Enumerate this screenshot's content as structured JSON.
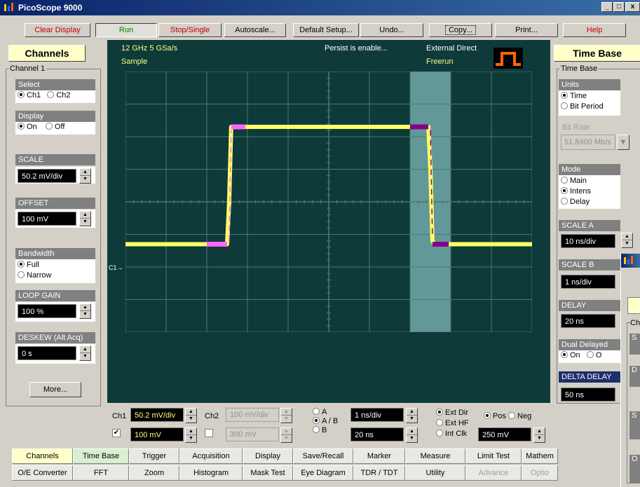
{
  "window": {
    "title": "PicoScope 9000",
    "controls": [
      "_",
      "□",
      "x"
    ]
  },
  "toolbar": {
    "clear_display": "Clear Display",
    "run": "Run",
    "stop_single": "Stop/Single",
    "autoscale": "Autoscale...",
    "default_setup": "Default Setup...",
    "undo": "Undo...",
    "copy": "Copy...",
    "print": "Print...",
    "help": "Help"
  },
  "channels_panel": {
    "header": "Channels",
    "group_label": "Channel 1",
    "select_label": "Select",
    "select_options": [
      "Ch1",
      "Ch2"
    ],
    "select_value": "Ch1",
    "display_label": "Display",
    "display_options": [
      "On",
      "Off"
    ],
    "display_value": "On",
    "scale_label": "SCALE",
    "scale_value": "50.2 mV/div",
    "offset_label": "OFFSET",
    "offset_value": "100 mV",
    "bandwidth_label": "Bandwidth",
    "bandwidth_options": [
      "Full",
      "Narrow"
    ],
    "bandwidth_value": "Full",
    "loop_gain_label": "LOOP GAIN",
    "loop_gain_value": "100 %",
    "deskew_label": "DESKEW (Alt Acq)",
    "deskew_value": "0 s",
    "more_button": "More..."
  },
  "scope": {
    "bandwidth_rate": "12 GHz  5 GSa/s",
    "mode": "Sample",
    "persist": "Persist  is enable...",
    "trigger_source": "External Direct",
    "trigger_mode": "Freerun",
    "channel_marker": "C1",
    "colors": {
      "background": "#0e3a3a",
      "grid": "#4a7a70",
      "trace": "#ffff66",
      "trace_highlight": "#ff66ff",
      "trace_delayed": "#880088",
      "window": "#7fb8b8"
    }
  },
  "chart_data": {
    "type": "line",
    "title": "",
    "xlabel": "",
    "ylabel": "",
    "grid": true,
    "divisions_x": 10,
    "divisions_y": 8,
    "timebase": "10 ns/div",
    "series": [
      {
        "name": "",
        "x_div": [
          0,
          2.5,
          2.55,
          2.6,
          2.65,
          7.45,
          7.5,
          7.55,
          7.6,
          10
        ],
        "y_div": [
          -1.3,
          -1.3,
          0,
          2.3,
          2.3,
          2.3,
          1.0,
          -1.2,
          -1.3,
          -1.3
        ]
      }
    ],
    "delayed_window_div": [
      7.0,
      8.0
    ]
  },
  "timebase_panel": {
    "header": "Time Base",
    "group_label": "Time Base",
    "units_label": "Units",
    "units_options": [
      "Time",
      "Bit Period"
    ],
    "units_value": "Time",
    "bit_rate_label": "Bit Rate",
    "bit_rate_value": "51.8400 Mb/s",
    "mode_label": "Mode",
    "mode_options": [
      "Main",
      "Intens",
      "Delay"
    ],
    "mode_value": "Intens",
    "scale_a_label": "SCALE A",
    "scale_a_value": "10 ns/div",
    "scale_b_label": "SCALE B",
    "scale_b_value": "1 ns/div",
    "delay_label": "DELAY",
    "delay_value": "20 ns",
    "dual_delayed_label": "Dual Delayed",
    "dual_delayed_options": [
      "On",
      "O"
    ],
    "dual_delayed_value": "On",
    "delta_delay_label": "DELTA DELAY",
    "delta_delay_value": "50 ns"
  },
  "bottom_controls": {
    "ch1_label": "Ch1",
    "ch1_scale": "50.2 mV/div",
    "ch1_offset": "100 mV",
    "ch2_label": "Ch2",
    "ch2_scale": "100 mV/div",
    "ch2_offset": "300 mV",
    "timebase_options": [
      "A",
      "A / B",
      "B"
    ],
    "timebase_value": "A / B",
    "timebase_a": "1 ns/div",
    "timebase_b": "20 ns",
    "trigger_options": [
      "Ext Dir",
      "Ext HF",
      "Int Clk"
    ],
    "trigger_value": "Ext Dir",
    "slope_options": [
      "Pos",
      "Neg"
    ],
    "slope_value": "Pos",
    "trigger_level": "250 mV"
  },
  "tabs_row1": [
    "Channels",
    "Time Base",
    "Trigger",
    "Acquisition",
    "Display",
    "Save/Recall",
    "Marker",
    "Measure",
    "Limit Test",
    "Mathem"
  ],
  "tabs_row2": [
    "O/E Converter",
    "FFT",
    "Zoom",
    "Histogram",
    "Mask Test",
    "Eye Diagram",
    "TDR / TDT",
    "Utility",
    "Advance",
    "Optio"
  ],
  "overlay_window": {
    "fragments": [
      "Ch",
      "S",
      "D",
      "S",
      "O"
    ]
  }
}
